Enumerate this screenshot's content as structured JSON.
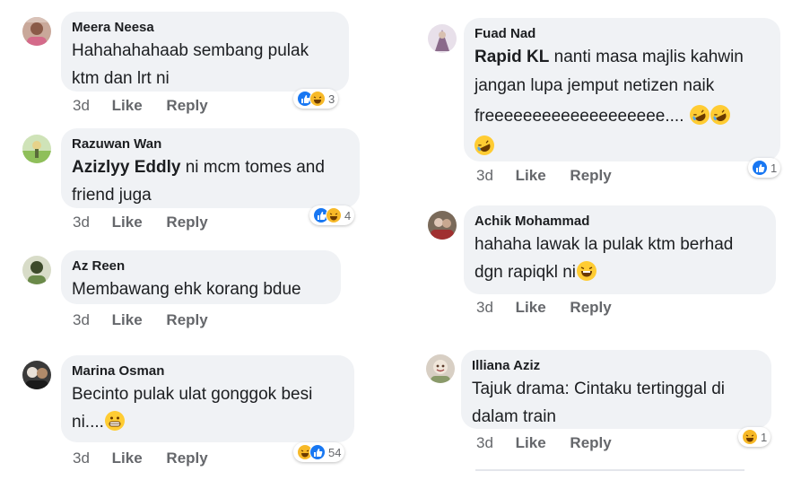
{
  "colors": {
    "like_blue": "#1877f2",
    "haha_yellow": "#f7b928",
    "bubble_bg": "#f0f2f5",
    "meta_gray": "#65676b"
  },
  "comments": [
    {
      "author": "Meera Neesa",
      "text_lines": [
        "Hahahahahaab sembang pulak",
        "ktm dan lrt ni"
      ],
      "time": "3d",
      "like": "Like",
      "reply": "Reply",
      "reactions": [
        "like-icon",
        "haha-icon"
      ],
      "reaction_count": "3"
    },
    {
      "author": "Razuwan Wan",
      "mention": "Azizlyy Eddly",
      "text_lines": [
        " ni mcm tomes and",
        "friend juga"
      ],
      "time": "3d",
      "like": "Like",
      "reply": "Reply",
      "reactions": [
        "like-icon",
        "haha-icon"
      ],
      "reaction_count": "4"
    },
    {
      "author": "Az Reen",
      "text_lines": [
        "Membawang ehk korang bdue"
      ],
      "time": "3d",
      "like": "Like",
      "reply": "Reply"
    },
    {
      "author": "Marina Osman",
      "text_lines": [
        "Becinto pulak ulat gonggok besi",
        "ni...."
      ],
      "emoji": [
        "grin-emoji"
      ],
      "time": "3d",
      "like": "Like",
      "reply": "Reply",
      "reactions": [
        "haha-icon",
        "like-icon"
      ],
      "reaction_count": "54"
    },
    {
      "author": "Fuad Nad",
      "mention": "Rapid KL",
      "text_lines": [
        " nanti masa majlis kahwin",
        "jangan lupa jemput netizen naik",
        "freeeeeeeeeeeeeeeeeee...."
      ],
      "emoji": [
        "rofl-emoji",
        "rofl-emoji",
        "rofl-emoji"
      ],
      "time": "3d",
      "like": "Like",
      "reply": "Reply",
      "reactions": [
        "like-icon"
      ],
      "reaction_count": "1"
    },
    {
      "author": "Achik Mohammad",
      "text_lines": [
        "hahaha lawak la pulak ktm berhad",
        "dgn rapiqkl ni"
      ],
      "emoji": [
        "laugh-emoji"
      ],
      "time": "3d",
      "like": "Like",
      "reply": "Reply"
    },
    {
      "author": "Illiana Aziz",
      "text_lines": [
        "Tajuk drama: Cintaku tertinggal di",
        "dalam train"
      ],
      "time": "3d",
      "like": "Like",
      "reply": "Reply",
      "reactions": [
        "haha-icon"
      ],
      "reaction_count": "1"
    }
  ]
}
